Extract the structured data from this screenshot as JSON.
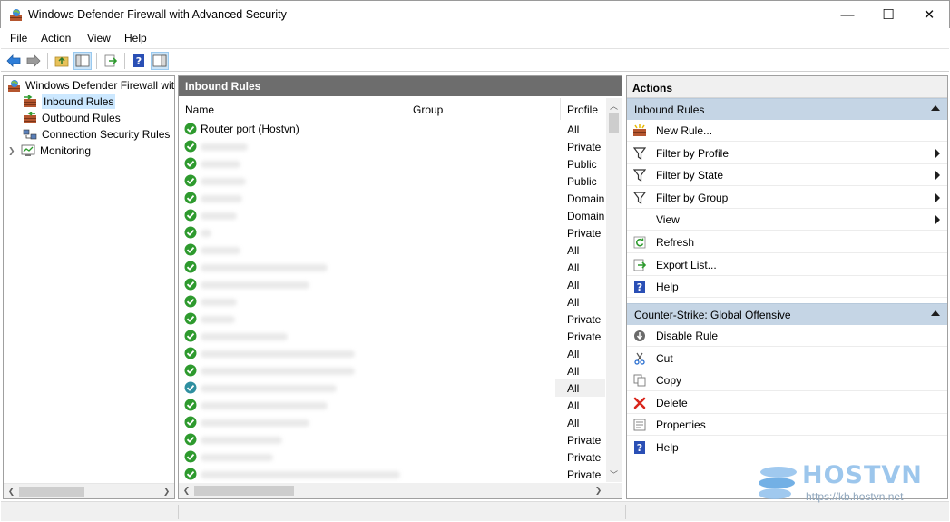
{
  "window": {
    "title": "Windows Defender Firewall with Advanced Security",
    "controls": {
      "minimize": "—",
      "maximize": "☐",
      "close": "✕"
    }
  },
  "menu": [
    "File",
    "Action",
    "View",
    "Help"
  ],
  "toolbar": {
    "icons": [
      "back-icon",
      "forward-icon",
      "up-folder-icon",
      "show-hide-tree-icon",
      "export-list-icon",
      "help-icon",
      "show-hide-action-pane-icon"
    ]
  },
  "tree": {
    "root": "Windows Defender Firewall with Advanced Security",
    "items": [
      {
        "label": "Inbound Rules",
        "selected": true
      },
      {
        "label": "Outbound Rules",
        "selected": false
      },
      {
        "label": "Connection Security Rules",
        "selected": false
      },
      {
        "label": "Monitoring",
        "selected": false
      }
    ]
  },
  "rules_panel": {
    "title": "Inbound Rules",
    "columns": {
      "name": "Name",
      "group": "Group",
      "profile": "Profile"
    },
    "rows": [
      {
        "name": "Router port (Hostvn)",
        "profile": "All",
        "blurred": false
      },
      {
        "name": "",
        "profile": "Private",
        "blurred": true
      },
      {
        "name": "",
        "profile": "Public",
        "blurred": true
      },
      {
        "name": "",
        "profile": "Public",
        "blurred": true
      },
      {
        "name": "",
        "profile": "Domain",
        "blurred": true
      },
      {
        "name": "",
        "profile": "Domain",
        "blurred": true
      },
      {
        "name": "",
        "profile": "Private",
        "blurred": true
      },
      {
        "name": "",
        "profile": "All",
        "blurred": true
      },
      {
        "name": "",
        "profile": "All",
        "blurred": true
      },
      {
        "name": "",
        "profile": "All",
        "blurred": true
      },
      {
        "name": "",
        "profile": "All",
        "blurred": true
      },
      {
        "name": "",
        "profile": "Private",
        "blurred": true
      },
      {
        "name": "",
        "profile": "Private",
        "blurred": true
      },
      {
        "name": "",
        "profile": "All",
        "blurred": true
      },
      {
        "name": "",
        "profile": "All",
        "blurred": true
      },
      {
        "name": "",
        "profile": "All",
        "blurred": true,
        "selected": true
      },
      {
        "name": "",
        "profile": "All",
        "blurred": true
      },
      {
        "name": "",
        "profile": "All",
        "blurred": true
      },
      {
        "name": "",
        "profile": "Private",
        "blurred": true
      },
      {
        "name": "",
        "profile": "Private",
        "blurred": true
      },
      {
        "name": "",
        "profile": "Private",
        "blurred": true
      }
    ]
  },
  "actions": {
    "title": "Actions",
    "group1": {
      "title": "Inbound Rules",
      "items": [
        {
          "label": "New Rule...",
          "icon": "new-rule-icon",
          "submenu": false
        },
        {
          "label": "Filter by Profile",
          "icon": "filter-icon",
          "submenu": true
        },
        {
          "label": "Filter by State",
          "icon": "filter-icon",
          "submenu": true
        },
        {
          "label": "Filter by Group",
          "icon": "filter-icon",
          "submenu": true
        },
        {
          "label": "View",
          "icon": "",
          "submenu": true
        },
        {
          "label": "Refresh",
          "icon": "refresh-icon",
          "submenu": false
        },
        {
          "label": "Export List...",
          "icon": "export-list-icon",
          "submenu": false
        },
        {
          "label": "Help",
          "icon": "help-icon",
          "submenu": false
        }
      ]
    },
    "group2": {
      "title": "Counter-Strike: Global Offensive",
      "items": [
        {
          "label": "Disable Rule",
          "icon": "disable-rule-icon",
          "submenu": false
        },
        {
          "label": "Cut",
          "icon": "cut-icon",
          "submenu": false
        },
        {
          "label": "Copy",
          "icon": "copy-icon",
          "submenu": false
        },
        {
          "label": "Delete",
          "icon": "delete-icon",
          "submenu": false
        },
        {
          "label": "Properties",
          "icon": "properties-icon",
          "submenu": false
        },
        {
          "label": "Help",
          "icon": "help-icon",
          "submenu": false
        }
      ]
    }
  },
  "watermark": {
    "brand": "HOSTVN",
    "url": "https://kb.hostvn.net"
  },
  "colors": {
    "panel_header": "#6d6d6d",
    "group_header": "#c5d5e5",
    "selection": "#cce8ff",
    "enabled_check": "#2e9a2e",
    "brand": "#9cc6ec"
  }
}
